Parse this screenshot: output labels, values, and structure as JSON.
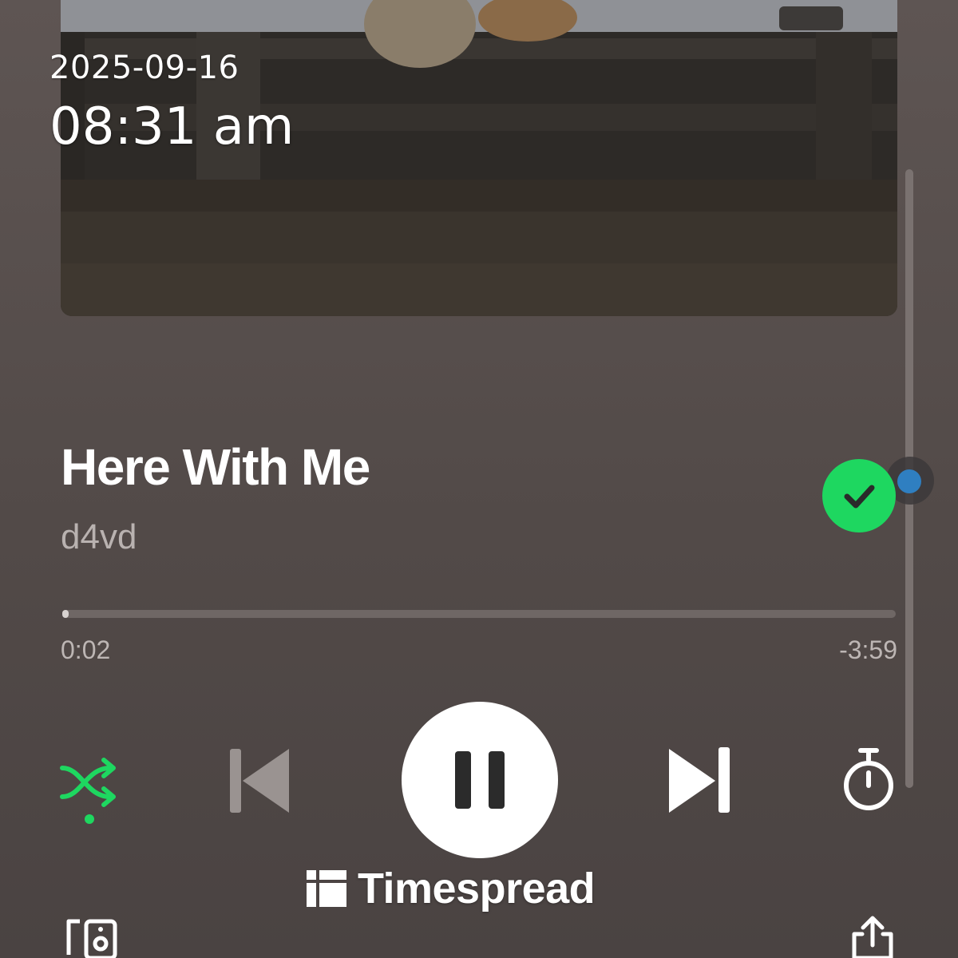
{
  "overlay": {
    "date": "2025-09-16",
    "time": "08:31 am"
  },
  "track": {
    "title": "Here With Me",
    "artist": "d4vd",
    "saved": true
  },
  "playback": {
    "elapsed": "0:02",
    "remaining": "-3:59",
    "progress_percent": 0.8,
    "state": "playing",
    "shuffle_enabled": true
  },
  "icons": {
    "shuffle": "shuffle-icon",
    "previous": "skip-previous-icon",
    "pause": "pause-icon",
    "next": "skip-next-icon",
    "timer": "sleep-timer-icon",
    "saved": "check-icon",
    "devices": "devices-icon",
    "share": "share-icon"
  },
  "colors": {
    "accent": "#1ed760",
    "background": "#524a48",
    "scroll_thumb": "#2f7fc1"
  },
  "watermark": {
    "text": "Timespread"
  }
}
